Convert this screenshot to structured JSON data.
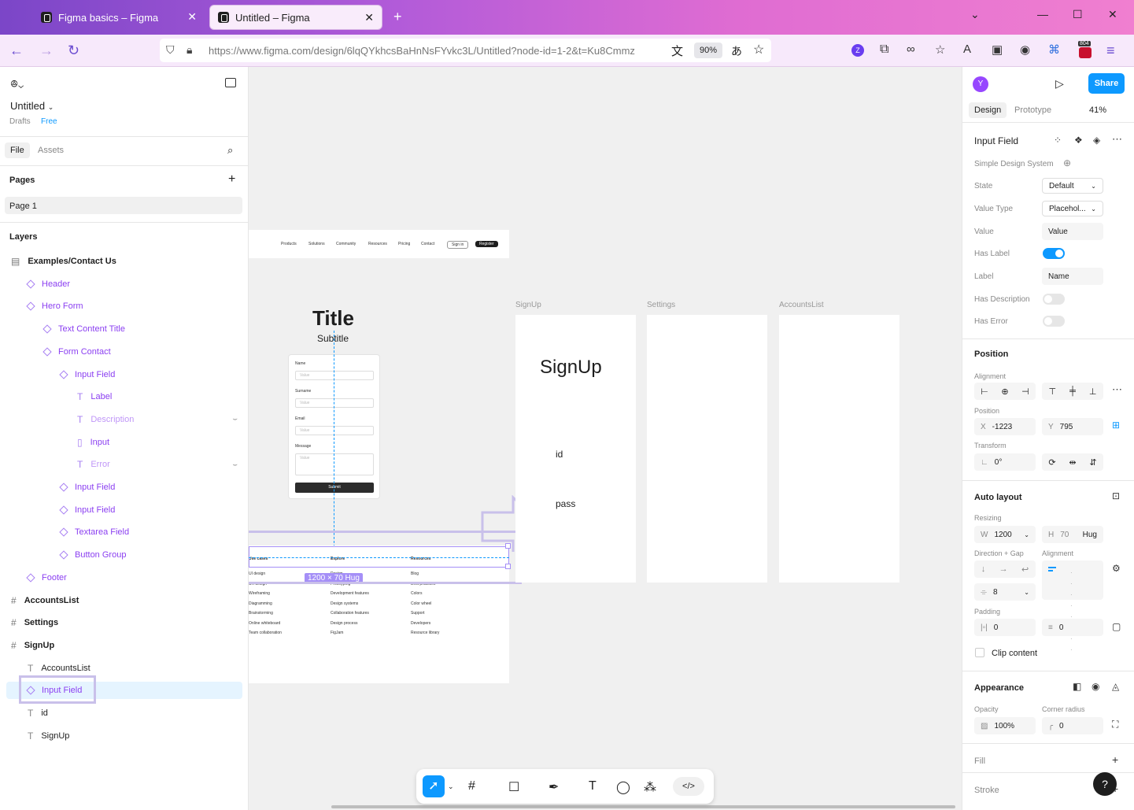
{
  "browser": {
    "tabs": [
      {
        "title": "Figma basics – Figma"
      },
      {
        "title": "Untitled – Figma"
      }
    ],
    "url": "https://www.figma.com/design/6lqQYkhcsBaHnNsFYvkc3L/Untitled?node-id=1-2&t=Ku8Cmmz",
    "zoom": "90%",
    "badge_count": "804",
    "profile_initial": "Z"
  },
  "left_panel": {
    "file_name": "Untitled",
    "location": "Drafts",
    "plan": "Free",
    "tabs": [
      "File",
      "Assets"
    ],
    "pages_title": "Pages",
    "pages": [
      "Page 1"
    ],
    "layers_title": "Layers",
    "layers": [
      {
        "name": "Examples/Contact Us",
        "type": "section",
        "indent": 0
      },
      {
        "name": "Header",
        "type": "component",
        "indent": 1
      },
      {
        "name": "Hero Form",
        "type": "component",
        "indent": 1
      },
      {
        "name": "Text Content Title",
        "type": "component",
        "indent": 2
      },
      {
        "name": "Form Contact",
        "type": "component",
        "indent": 2
      },
      {
        "name": "Input Field",
        "type": "component",
        "indent": 3
      },
      {
        "name": "Label",
        "type": "text-comp",
        "indent": 4
      },
      {
        "name": "Description",
        "type": "text-hidden",
        "indent": 4
      },
      {
        "name": "Input",
        "type": "input-comp",
        "indent": 4
      },
      {
        "name": "Error",
        "type": "text-hidden",
        "indent": 4
      },
      {
        "name": "Input Field",
        "type": "component",
        "indent": 3
      },
      {
        "name": "Input Field",
        "type": "component",
        "indent": 3
      },
      {
        "name": "Textarea Field",
        "type": "component",
        "indent": 3
      },
      {
        "name": "Button Group",
        "type": "component",
        "indent": 3
      },
      {
        "name": "Footer",
        "type": "component",
        "indent": 1
      },
      {
        "name": "AccountsList",
        "type": "frame",
        "indent": 0
      },
      {
        "name": "Settings",
        "type": "frame",
        "indent": 0
      },
      {
        "name": "SignUp",
        "type": "frame",
        "indent": 0
      },
      {
        "name": "AccountsList",
        "type": "text",
        "indent": 1
      },
      {
        "name": "Input Field",
        "type": "component-selected",
        "indent": 1
      },
      {
        "name": "id",
        "type": "text",
        "indent": 1
      },
      {
        "name": "SignUp",
        "type": "text",
        "indent": 1
      }
    ]
  },
  "canvas": {
    "nav_items": [
      "Products",
      "Solutions",
      "Community",
      "Resources",
      "Pricing",
      "Contact"
    ],
    "nav_sign_in": "Sign in",
    "nav_register": "Register",
    "title": "Title",
    "subtitle": "Subtitle",
    "form_labels": [
      "Name",
      "Surname",
      "Email",
      "Message"
    ],
    "form_placeholder": "Value",
    "submit": "Submit",
    "frame_labels": [
      "SignUp",
      "Settings",
      "AccountsList"
    ],
    "signup_heading": "SignUp",
    "signup_id": "id",
    "signup_pass": "pass",
    "size_badge": "1200 × 70 Hug",
    "footer_headers": [
      "Use cases",
      "Explore",
      "Resources"
    ],
    "footer_col1": [
      "UI design",
      "UX design",
      "Wireframing",
      "Diagramming",
      "Brainstorming",
      "Online whiteboard",
      "Team collaboration"
    ],
    "footer_col2": [
      "Design",
      "Prototyping",
      "Development features",
      "Design systems",
      "Collaboration features",
      "Design process",
      "FigJam"
    ],
    "footer_col3": [
      "Blog",
      "Best practices",
      "Colors",
      "Color wheel",
      "Support",
      "Developers",
      "Resource library"
    ]
  },
  "right_panel": {
    "avatar": "Y",
    "share": "Share",
    "tabs": [
      "Design",
      "Prototype"
    ],
    "zoom": "41%",
    "component_name": "Input Field",
    "library": "Simple Design System",
    "props": {
      "state_label": "State",
      "state_value": "Default",
      "value_type_label": "Value Type",
      "value_type_value": "Placehol...",
      "value_label": "Value",
      "value_value": "Value",
      "has_label_label": "Has Label",
      "label_label": "Label",
      "label_value": "Name",
      "has_description_label": "Has Description",
      "has_error_label": "Has Error"
    },
    "position": {
      "title": "Position",
      "alignment_label": "Alignment",
      "position_label": "Position",
      "x_label": "X",
      "x": "-1223",
      "y_label": "Y",
      "y": "795",
      "transform_label": "Transform",
      "rotation": "0°"
    },
    "auto_layout": {
      "title": "Auto layout",
      "resizing_label": "Resizing",
      "w_label": "W",
      "w": "1200",
      "h_label": "H",
      "h": "70",
      "h_mode": "Hug",
      "direction_label": "Direction + Gap",
      "alignment_label": "Alignment",
      "gap": "8",
      "padding_label": "Padding",
      "pad_h": "0",
      "pad_v": "0",
      "clip_content": "Clip content"
    },
    "appearance": {
      "title": "Appearance",
      "opacity_label": "Opacity",
      "opacity": "100%",
      "radius_label": "Corner radius",
      "radius": "0"
    },
    "fill": "Fill",
    "stroke": "Stroke"
  },
  "colors": {
    "accent": "#0d99ff",
    "component": "#8b3ff1",
    "selection": "#a58ff7"
  }
}
